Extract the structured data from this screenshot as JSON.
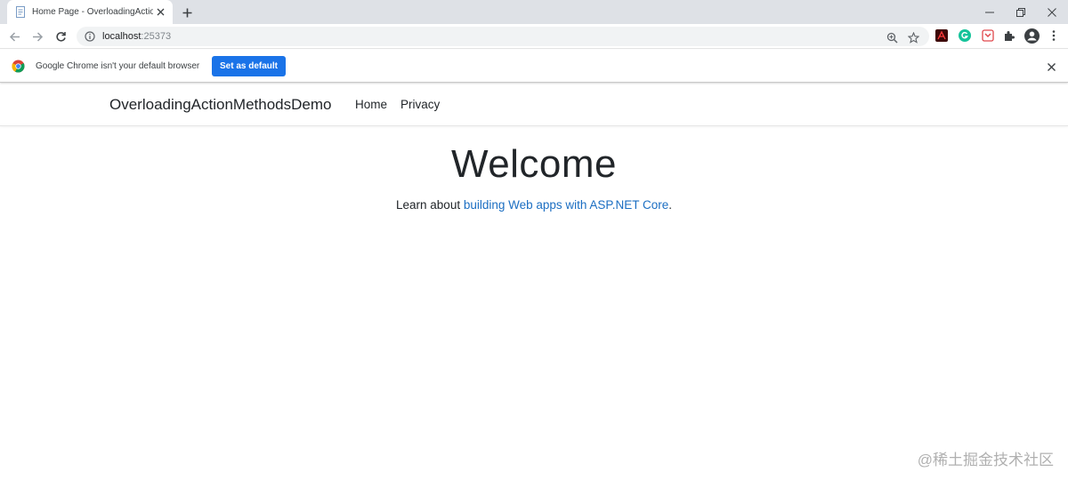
{
  "browser": {
    "tab": {
      "title": "Home Page - OverloadingActionMethodsDemo"
    },
    "address": {
      "host": "localhost",
      "port": ":25373"
    },
    "infobar": {
      "message": "Google Chrome isn't your default browser",
      "button_label": "Set as default"
    },
    "extensions": [
      "pdf-extension-icon",
      "grammarly-icon",
      "pocket-icon",
      "extensions-puzzle-icon"
    ],
    "colors": {
      "accent": "#1a73e8",
      "link": "#1b6ec2",
      "tabstrip": "#dee1e6"
    }
  },
  "site": {
    "brand": "OverloadingActionMethodsDemo",
    "nav": [
      {
        "label": "Home"
      },
      {
        "label": "Privacy"
      }
    ],
    "main": {
      "heading": "Welcome",
      "lead_text": "Learn about ",
      "link_text": "building Web apps with ASP.NET Core",
      "trailing": "."
    }
  },
  "watermark": "@稀土掘金技术社区"
}
